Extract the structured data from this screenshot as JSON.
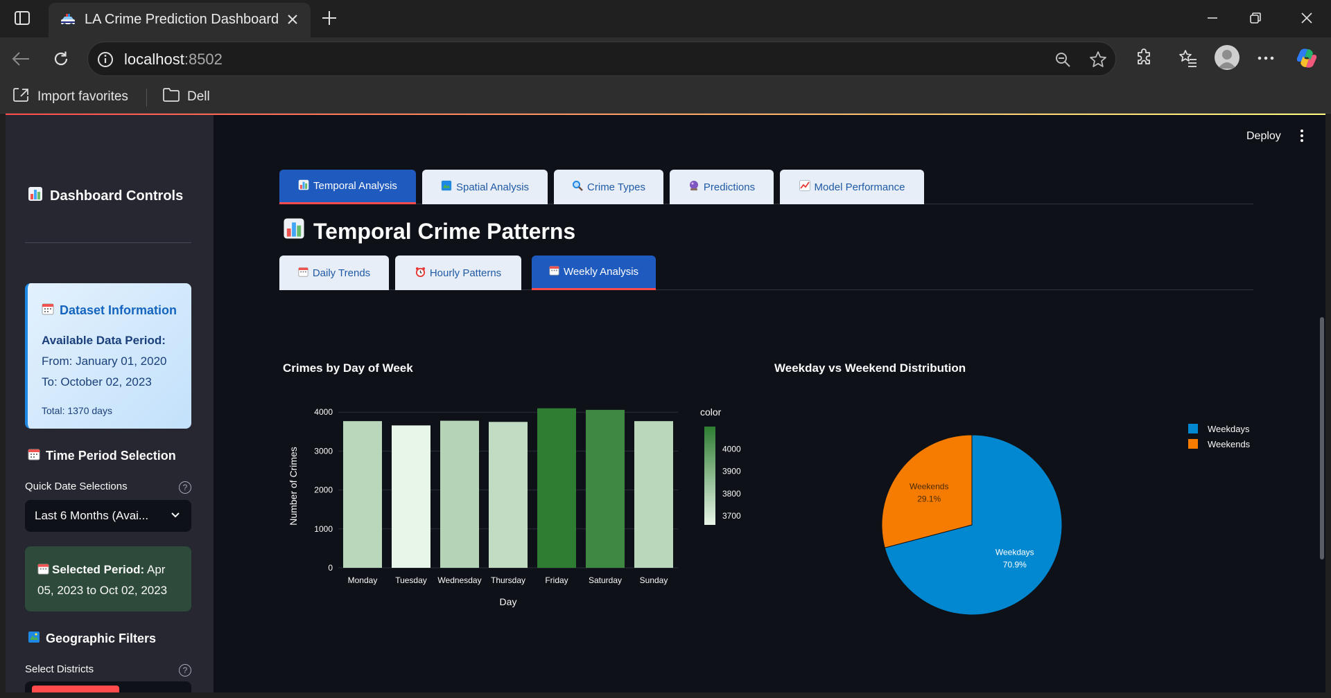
{
  "browser": {
    "tab_title": "LA Crime Prediction Dashboard",
    "url_host": "localhost",
    "url_port": ":8502",
    "favorites": [
      "Import favorites",
      "Dell"
    ]
  },
  "header": {
    "deploy_label": "Deploy"
  },
  "sidebar": {
    "title": "Dashboard Controls",
    "dataset_card": {
      "title": "Dataset Information",
      "subtitle": "Available Data Period:",
      "from": "From: January 01, 2020",
      "to": "To: October 02, 2023",
      "total": "Total: 1370 days"
    },
    "time_period_heading": "Time Period Selection",
    "quick_date_label": "Quick Date Selections",
    "quick_date_value": "Last 6 Months (Avai...",
    "selected_period_label": "Selected Period:",
    "selected_period_value": "Apr 05, 2023 to Oct 02, 2023",
    "geo_heading": "Geographic Filters",
    "districts_label": "Select Districts"
  },
  "main_tabs": [
    "Temporal Analysis",
    "Spatial Analysis",
    "Crime Types",
    "Predictions",
    "Model Performance"
  ],
  "active_main_tab": 0,
  "page_title": "Temporal Crime Patterns",
  "sub_tabs": [
    "Daily Trends",
    "Hourly Patterns",
    "Weekly Analysis"
  ],
  "active_sub_tab": 2,
  "colors": {
    "bar_dark": "#2e7d32",
    "bar_light": "#e8f5e9",
    "pie_weekdays": "#0288d1",
    "pie_weekends": "#f57c00",
    "accent": "#ff4b4b"
  },
  "chart_data": [
    {
      "type": "bar",
      "title": "Crimes by Day of Week",
      "xlabel": "Day",
      "ylabel": "Number of Crimes",
      "categories": [
        "Monday",
        "Tuesday",
        "Wednesday",
        "Thursday",
        "Friday",
        "Saturday",
        "Sunday"
      ],
      "values": [
        3770,
        3660,
        3780,
        3750,
        4100,
        4060,
        3770
      ],
      "ylim": [
        0,
        4200
      ],
      "yticks": [
        0,
        1000,
        2000,
        3000,
        4000
      ],
      "colorbar": {
        "title": "color",
        "ticks": [
          3700,
          3800,
          3900,
          4000
        ],
        "range": [
          3660,
          4100
        ]
      },
      "grid": true
    },
    {
      "type": "pie",
      "title": "Weekday vs Weekend Distribution",
      "labels": [
        "Weekdays",
        "Weekends"
      ],
      "values": [
        70.9,
        29.1
      ],
      "value_labels": [
        "70.9%",
        "29.1%"
      ],
      "legend_position": "top-right"
    }
  ]
}
